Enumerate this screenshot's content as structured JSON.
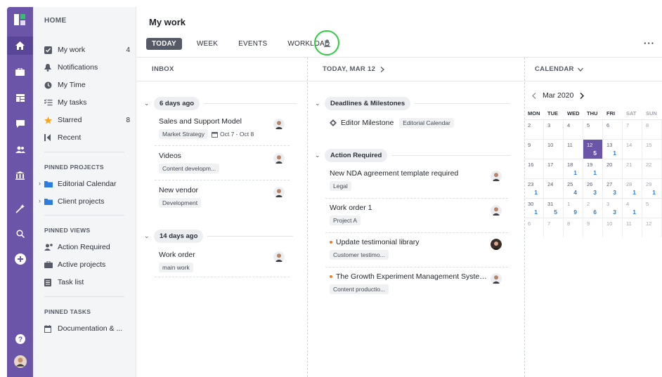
{
  "header": {
    "title": "My work",
    "tabs": [
      "TODAY",
      "WEEK",
      "EVENTS",
      "WORKLOAD"
    ],
    "more_label": "···"
  },
  "sidebar": {
    "home_label": "HOME",
    "items": [
      {
        "label": "My work",
        "count": "4",
        "icon": "check-square-icon"
      },
      {
        "label": "Notifications",
        "count": "",
        "icon": "bell-icon"
      },
      {
        "label": "My Time",
        "count": "",
        "icon": "clock-icon"
      },
      {
        "label": "My tasks",
        "count": "",
        "icon": "checklist-icon"
      },
      {
        "label": "Starred",
        "count": "8",
        "icon": "star-icon"
      },
      {
        "label": "Recent",
        "count": "",
        "icon": "recent-icon"
      }
    ],
    "pinned_projects_label": "PINNED PROJECTS",
    "pinned_projects": [
      "Editorial Calendar",
      "Client projects"
    ],
    "pinned_views_label": "PINNED VIEWS",
    "pinned_views": [
      "Action Required",
      "Active projects",
      "Task list"
    ],
    "pinned_tasks_label": "PINNED TASKS",
    "pinned_tasks": [
      "Documentation & ..."
    ]
  },
  "inbox": {
    "header": "INBOX",
    "groups": [
      {
        "label": "6 days ago",
        "items": [
          {
            "title": "Sales and Support Model",
            "tag": "Market Strategy",
            "date": "Oct 7 - Oct 8"
          },
          {
            "title": "Videos",
            "tag": "Content developm..."
          },
          {
            "title": "New vendor",
            "tag": "Development"
          }
        ]
      },
      {
        "label": "14 days ago",
        "items": [
          {
            "title": "Work order",
            "tag": "main work"
          }
        ]
      }
    ]
  },
  "today": {
    "header": "TODAY, MAR 12",
    "groups": [
      {
        "label": "Deadlines & Milestones",
        "items": [
          {
            "title": "Editor Milestone",
            "tag": "Editorial Calendar"
          }
        ]
      },
      {
        "label": "Action Required",
        "items": [
          {
            "title": "New NDA agreement template required",
            "tag": "Legal"
          },
          {
            "title": "Work order 1",
            "tag": "Project A"
          },
          {
            "title": "Update testimonial library",
            "tag": "Customer testimo..."
          },
          {
            "title": "The Growth Experiment Management System...",
            "tag": "Content productio..."
          }
        ]
      }
    ]
  },
  "calendar": {
    "header": "CALENDAR",
    "month": "Mar 2020",
    "dows": [
      "MON",
      "TUE",
      "WED",
      "THU",
      "FRI",
      "SAT",
      "SUN"
    ],
    "weeks": [
      [
        {
          "d": "2",
          "e": ""
        },
        {
          "d": "3",
          "e": ""
        },
        {
          "d": "4",
          "e": ""
        },
        {
          "d": "5",
          "e": ""
        },
        {
          "d": "6",
          "e": ""
        },
        {
          "d": "7",
          "e": ""
        },
        {
          "d": "8",
          "e": ""
        }
      ],
      [
        {
          "d": "9",
          "e": ""
        },
        {
          "d": "10",
          "e": ""
        },
        {
          "d": "11",
          "e": ""
        },
        {
          "d": "12",
          "e": "5"
        },
        {
          "d": "13",
          "e": "1"
        },
        {
          "d": "14",
          "e": ""
        },
        {
          "d": "15",
          "e": ""
        }
      ],
      [
        {
          "d": "16",
          "e": ""
        },
        {
          "d": "17",
          "e": ""
        },
        {
          "d": "18",
          "e": "1"
        },
        {
          "d": "19",
          "e": "1"
        },
        {
          "d": "20",
          "e": ""
        },
        {
          "d": "21",
          "e": ""
        },
        {
          "d": "22",
          "e": ""
        }
      ],
      [
        {
          "d": "23",
          "e": "1"
        },
        {
          "d": "24",
          "e": ""
        },
        {
          "d": "25",
          "e": "4"
        },
        {
          "d": "26",
          "e": "3"
        },
        {
          "d": "27",
          "e": "3"
        },
        {
          "d": "28",
          "e": "1"
        },
        {
          "d": "29",
          "e": "1"
        }
      ],
      [
        {
          "d": "30",
          "e": "1"
        },
        {
          "d": "31",
          "e": "5"
        },
        {
          "d": "1",
          "e": "9"
        },
        {
          "d": "2",
          "e": "6"
        },
        {
          "d": "3",
          "e": "3"
        },
        {
          "d": "4",
          "e": "1"
        },
        {
          "d": "5",
          "e": ""
        }
      ],
      [
        {
          "d": "6",
          "e": ""
        },
        {
          "d": "7",
          "e": ""
        },
        {
          "d": "8",
          "e": ""
        },
        {
          "d": "9",
          "e": ""
        },
        {
          "d": "10",
          "e": ""
        },
        {
          "d": "11",
          "e": ""
        },
        {
          "d": "12",
          "e": ""
        }
      ]
    ]
  },
  "colors": {
    "accent": "#6a55a8",
    "highlight_ring": "#2ecc40",
    "event_count": "#2a7de1"
  }
}
